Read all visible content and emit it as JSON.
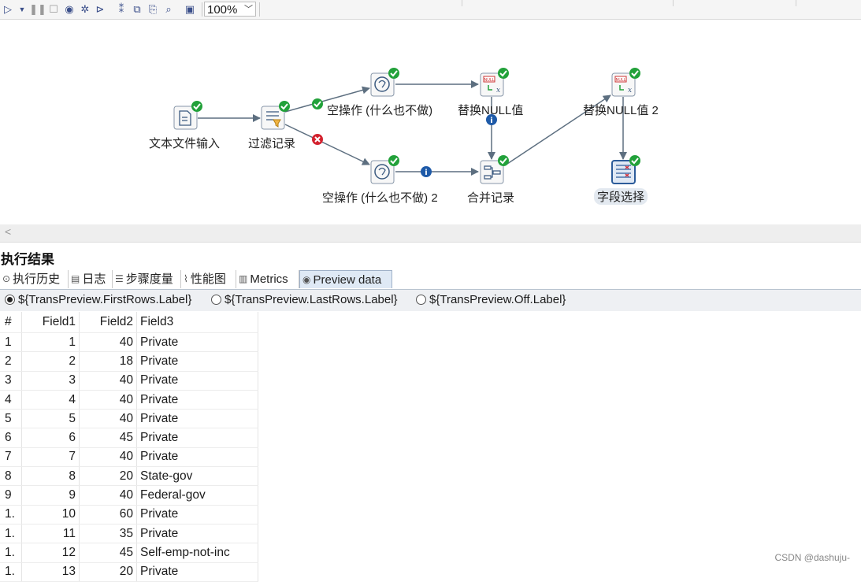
{
  "toolbar": {
    "icons": [
      "run-icon",
      "run-dropdown-icon",
      "pause-icon",
      "stop-icon",
      "preview-icon",
      "debug-icon",
      "replay-icon",
      "verify-icon",
      "analyze-icon",
      "sql-icon",
      "explore-icon",
      "layout-icon"
    ],
    "zoom_value": "100%"
  },
  "canvas": {
    "nodes": {
      "text_input": "文本文件输入",
      "filter": "过滤记录",
      "dummy1": "空操作 (什么也不做)",
      "dummy2": "空操作 (什么也不做) 2",
      "ifnull1": "替换NULL值",
      "ifnull2": "替换NULL值 2",
      "merge": "合并记录",
      "select": "字段选择"
    }
  },
  "results": {
    "title": "执行结果",
    "tabs": [
      "执行历史",
      "日志",
      "步骤度量",
      "性能图",
      "Metrics",
      "Preview data"
    ],
    "radios": [
      "${TransPreview.FirstRows.Label}",
      "${TransPreview.LastRows.Label}",
      "${TransPreview.Off.Label}"
    ],
    "columns": [
      "#",
      "Field1",
      "Field2",
      "Field3"
    ],
    "rows": [
      [
        "1",
        "1",
        "40",
        "Private"
      ],
      [
        "2",
        "2",
        "18",
        "Private"
      ],
      [
        "3",
        "3",
        "40",
        "Private"
      ],
      [
        "4",
        "4",
        "40",
        "Private"
      ],
      [
        "5",
        "5",
        "40",
        "Private"
      ],
      [
        "6",
        "6",
        "45",
        "Private"
      ],
      [
        "7",
        "7",
        "40",
        "Private"
      ],
      [
        "8",
        "8",
        "20",
        "State-gov"
      ],
      [
        "9",
        "9",
        "40",
        "Federal-gov"
      ],
      [
        "1.",
        "10",
        "60",
        "Private"
      ],
      [
        "1.",
        "11",
        "35",
        "Private"
      ],
      [
        "1.",
        "12",
        "45",
        "Self-emp-not-inc"
      ],
      [
        "1.",
        "13",
        "20",
        "Private"
      ]
    ]
  },
  "watermark": "CSDN @dashuju-"
}
